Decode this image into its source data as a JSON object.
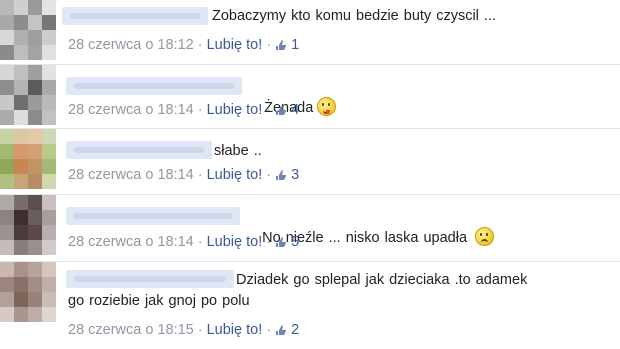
{
  "comments": [
    {
      "text": "Zobaczymy kto komu bedzie buty czyscil ...",
      "time": "28 czerwca o 18:12",
      "like": "Lubię to!",
      "likes": "1",
      "emoji": null,
      "avatar_colors": [
        "#b8b8b8",
        "#cfcfcf",
        "#9a9a9a",
        "#e4e4e4",
        "#a9a9a9",
        "#8d8d8d",
        "#c4c4c4",
        "#777777",
        "#d8d8d8",
        "#b0b0b0",
        "#9e9e9e",
        "#cdcdcd",
        "#8a8a8a",
        "#bdbdbd",
        "#a3a3a3",
        "#e0e0e0"
      ]
    },
    {
      "text": "Żenada",
      "time": "28 czerwca o 18:14",
      "like": "Lubię to!",
      "likes": "4",
      "emoji": "tongue-emoji",
      "avatar_colors": [
        "#d6d6d6",
        "#bfbfbf",
        "#9f9f9f",
        "#e2e2e2",
        "#8e8e8e",
        "#b4b4b4",
        "#5c5c5c",
        "#a9a9a9",
        "#c8c8c8",
        "#6f6f6f",
        "#9b9b9b",
        "#bababa",
        "#aaaaaa",
        "#dddddd",
        "#8c8c8c",
        "#c2c2c2"
      ]
    },
    {
      "text": "słabe ..",
      "time": "28 czerwca o 18:14",
      "like": "Lubię to!",
      "likes": "3",
      "emoji": null,
      "avatar_colors": [
        "#c7d3a6",
        "#dcc7a0",
        "#e6c9a8",
        "#cdd9b6",
        "#a4b872",
        "#d89a6a",
        "#d3a274",
        "#b9c98c",
        "#8fa75a",
        "#c7874f",
        "#c39463",
        "#a5b976",
        "#b1c184",
        "#c9a47a",
        "#b98d61",
        "#d0d6b0"
      ]
    },
    {
      "text": "No nieźle ... nisko laska upadła",
      "time": "28 czerwca o 18:14",
      "like": "Lubię to!",
      "likes": "5",
      "emoji": "sad-emoji",
      "avatar_colors": [
        "#b0a8a6",
        "#7a6c6a",
        "#5d4f4e",
        "#c9c1bf",
        "#8f8381",
        "#3c302f",
        "#6b5d5b",
        "#a89e9c",
        "#9d9290",
        "#4a3e3d",
        "#594a49",
        "#b7afad",
        "#c4bcba",
        "#8a7e7c",
        "#9a8f8d",
        "#d1caca"
      ]
    },
    {
      "text": "Dziadek go splepal jak dzieciaka .to adamek\ngo roziebie jak gnoj po polu",
      "time": "28 czerwca o 18:15",
      "like": "Lubię to!",
      "likes": "2",
      "emoji": null,
      "avatar_colors": [
        "#c9b8b0",
        "#a89289",
        "#b8a39a",
        "#d4c6bf",
        "#9b857c",
        "#8a7168",
        "#a38d84",
        "#c2b0a8",
        "#b3a097",
        "#7d655c",
        "#98827a",
        "#cbbcb5",
        "#d6cac4",
        "#a9968e",
        "#bfaea6",
        "#e0d6d1"
      ]
    }
  ]
}
